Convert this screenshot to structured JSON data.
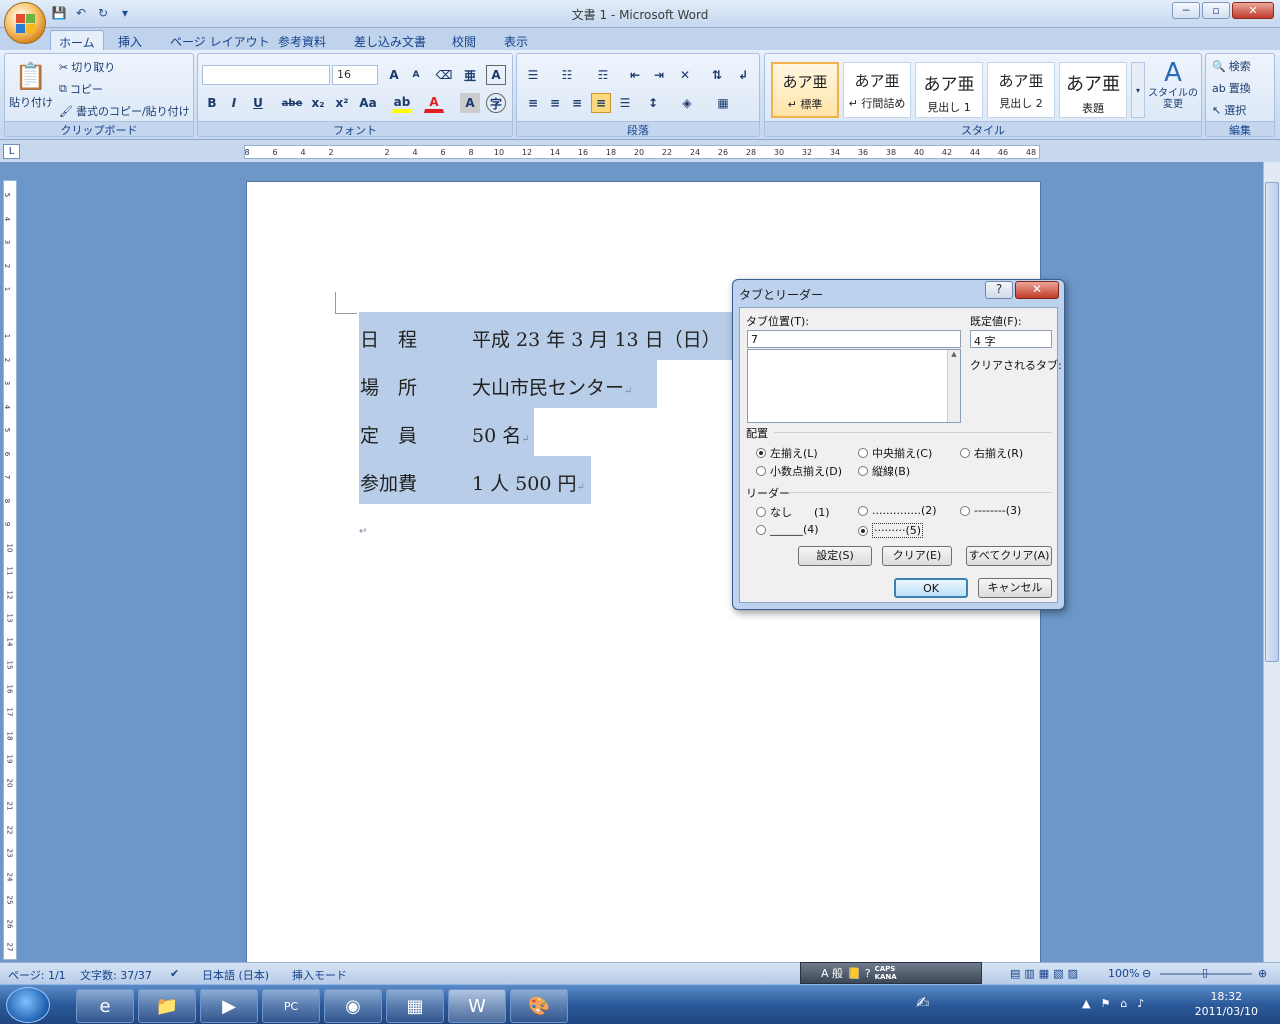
{
  "window": {
    "title": "文書 1 - Microsoft Word",
    "minimize": "─",
    "restore": "▫",
    "close": "✕"
  },
  "qat": {
    "save": "💾",
    "undo": "↶",
    "redo": "↻",
    "more": "▾"
  },
  "tabs": [
    "ホーム",
    "挿入",
    "ページ レイアウト",
    "参考資料",
    "差し込み文書",
    "校閲",
    "表示"
  ],
  "ribbon": {
    "clipboard": {
      "label": "クリップボード",
      "paste": "貼り付け",
      "cut": "切り取り",
      "copy": "コピー",
      "format_painter": "書式のコピー/貼り付け"
    },
    "font": {
      "label": "フォント",
      "font_name": "",
      "font_size": "16",
      "bold": "B",
      "italic": "I",
      "underline": "U",
      "strike": "abe",
      "sub": "x₂",
      "sup": "x²",
      "case": "Aa",
      "grow": "A",
      "shrink": "A",
      "highlight_color": "#ffff00",
      "font_color": "#e02020"
    },
    "paragraph": {
      "label": "段落"
    },
    "styles": {
      "label": "スタイル",
      "items": [
        {
          "preview": "あア亜",
          "name": "↵ 標準"
        },
        {
          "preview": "あア亜",
          "name": "↵ 行間詰め"
        },
        {
          "preview": "あア亜",
          "name": "見出し 1"
        },
        {
          "preview": "あア亜",
          "name": "見出し 2"
        },
        {
          "preview": "あア亜",
          "name": "表題"
        }
      ],
      "change_styles": "スタイルの変更"
    },
    "editing": {
      "label": "編集",
      "find": "検索",
      "replace": "置換",
      "select": "選択"
    }
  },
  "ruler_ticks": [
    "8",
    "6",
    "4",
    "2",
    "",
    "2",
    "4",
    "6",
    "8",
    "10",
    "12",
    "14",
    "16",
    "18",
    "20",
    "22",
    "24",
    "26",
    "28",
    "30",
    "32",
    "34",
    "36",
    "38",
    "40",
    "42",
    "44",
    "46",
    "48"
  ],
  "vruler_ticks": [
    "5",
    "4",
    "3",
    "2",
    "1",
    "",
    "1",
    "2",
    "3",
    "4",
    "5",
    "6",
    "7",
    "8",
    "9",
    "10",
    "11",
    "12",
    "13",
    "14",
    "15",
    "16",
    "17",
    "18",
    "19",
    "20",
    "21",
    "22",
    "23",
    "24",
    "25",
    "26",
    "27"
  ],
  "document": {
    "lines": [
      {
        "label": "日　程",
        "value": "平成 23 年 3 月 13 日（日）"
      },
      {
        "label": "場　所",
        "value": "大山市民センター"
      },
      {
        "label": "定　員",
        "value": "50 名"
      },
      {
        "label": "参加費",
        "value": "1 人 500 円"
      }
    ],
    "para_mark": "↵"
  },
  "dialog": {
    "title": "タブとリーダー",
    "help": "?",
    "close": "✕",
    "tab_position_label": "タブ位置(T):",
    "tab_position_value": "7",
    "default_label": "既定値(F):",
    "default_value": "4 字",
    "cleared_label": "クリアされるタブ:",
    "alignment_label": "配置",
    "alignment": [
      {
        "label": "左揃え(L)",
        "checked": true
      },
      {
        "label": "中央揃え(C)",
        "checked": false
      },
      {
        "label": "右揃え(R)",
        "checked": false
      },
      {
        "label": "小数点揃え(D)",
        "checked": false
      },
      {
        "label": "縦線(B)",
        "checked": false
      }
    ],
    "leader_label": "リーダー",
    "leaders": [
      {
        "label": "なし　　(1)",
        "checked": false
      },
      {
        "label": "..............(2)",
        "checked": false
      },
      {
        "label": "--------(3)",
        "checked": false
      },
      {
        "label": "______(4)",
        "checked": false
      },
      {
        "label": "·········(5)",
        "checked": true
      }
    ],
    "set_button": "設定(S)",
    "clear_button": "クリア(E)",
    "clear_all_button": "すべてクリア(A)",
    "ok_button": "OK",
    "cancel_button": "キャンセル"
  },
  "status": {
    "page": "ページ: 1/1",
    "words": "文字数: 37/37",
    "language": "日本語 (日本)",
    "mode": "挿入モード",
    "zoom": "100%"
  },
  "ime": {
    "mode": "A 般",
    "caps": "CAPS",
    "kana": "KANA"
  },
  "taskbar": {
    "time": "18:32",
    "date": "2011/03/10"
  }
}
